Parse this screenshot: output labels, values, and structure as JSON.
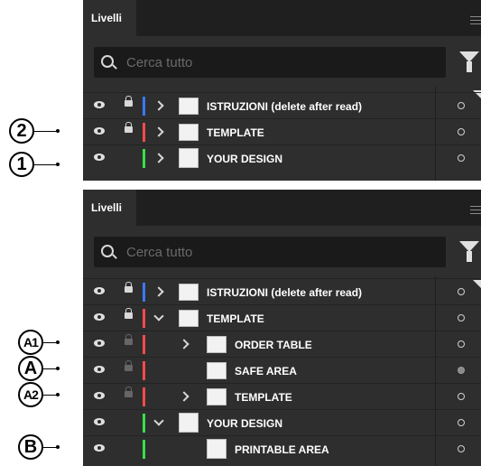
{
  "panel1": {
    "tab": "Livelli",
    "search_placeholder": "Cerca tutto",
    "rows": [
      {
        "label": "ISTRUZIONI (delete after read)",
        "color": "#3a78ff",
        "locked": true,
        "expanded": false
      },
      {
        "label": "TEMPLATE",
        "color": "#ff4a4a",
        "locked": true,
        "expanded": false
      },
      {
        "label": "YOUR DESIGN",
        "color": "#35e24a",
        "locked": false,
        "expanded": false
      }
    ]
  },
  "panel2": {
    "tab": "Livelli",
    "search_placeholder": "Cerca tutto",
    "rows": [
      {
        "label": "ISTRUZIONI (delete after read)",
        "color": "#3a78ff",
        "locked": true,
        "expanded": false
      },
      {
        "label": "TEMPLATE",
        "color": "#ff4a4a",
        "locked": true,
        "expanded": true
      },
      {
        "label": "ORDER TABLE",
        "color": "#ff4a4a",
        "locked": true,
        "expanded": false
      },
      {
        "label": "SAFE AREA",
        "color": "#ff4a4a",
        "locked": true,
        "expanded": false,
        "target_filled": true
      },
      {
        "label": "TEMPLATE",
        "color": "#ff4a4a",
        "locked": true,
        "expanded": false
      },
      {
        "label": "YOUR DESIGN",
        "color": "#35e24a",
        "locked": false,
        "expanded": true
      },
      {
        "label": "PRINTABLE AREA",
        "color": "#35e24a",
        "locked": false,
        "expanded": false
      }
    ]
  },
  "callouts": {
    "two": "2",
    "one": "1",
    "a1": "A1",
    "a": "A",
    "a2": "A2",
    "b": "B"
  },
  "icons": {
    "visibility": "eye-icon",
    "lock": "lock-icon",
    "expand": "chevron-icon",
    "search": "search-icon",
    "filter": "funnel-icon",
    "target": "target-circle-icon",
    "menu": "panel-menu-icon"
  }
}
